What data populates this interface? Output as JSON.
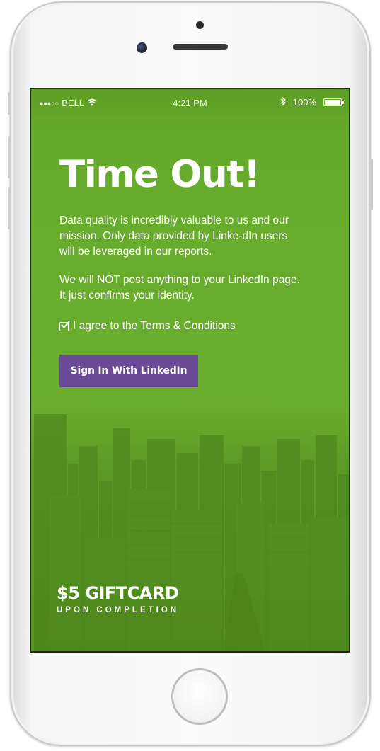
{
  "status_bar": {
    "signal": "●●●○○",
    "carrier": "BELL",
    "time": "4:21 PM",
    "battery_percent": "100%",
    "icons": [
      "signal-dots-icon",
      "wifi-icon",
      "bluetooth-icon",
      "battery-icon"
    ]
  },
  "main": {
    "title": "Time Out!",
    "paragraph_1": "Data quality is incredibly valuable to us and our mission. Only data provided by Linke-dIn users will be leveraged in our reports.",
    "paragraph_2": "We will NOT post anything to your LinkedIn page. It just confirms your identity.",
    "agree_label": "I agree to the Terms & Conditions",
    "agree_checked": true,
    "signin_button": "Sign In With LinkedIn"
  },
  "promo": {
    "headline": "$5 GIFTCARD",
    "subline": "UPON COMPLETION"
  },
  "colors": {
    "background_green": "#69ad2e",
    "button_purple": "#6b4a96",
    "text": "#ffffff"
  }
}
